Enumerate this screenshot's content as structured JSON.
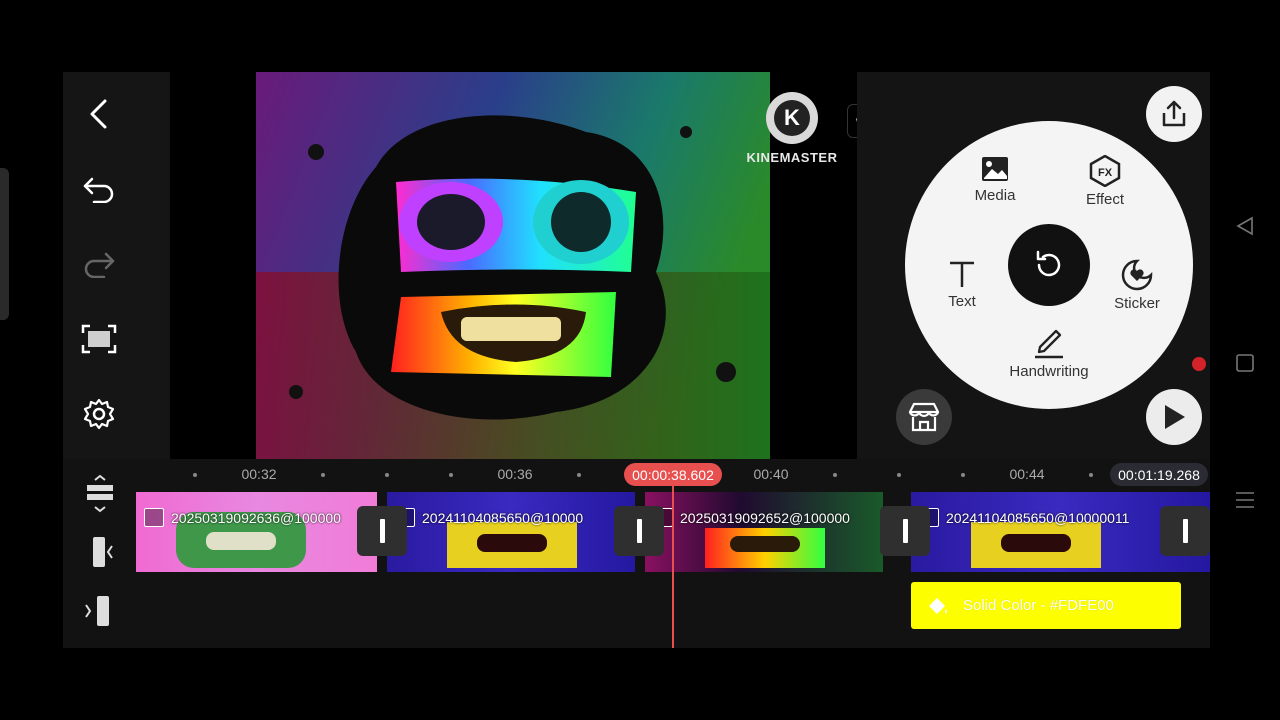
{
  "brand": {
    "name": "KINEMASTER",
    "logo_letter": "K"
  },
  "left_toolbar": [
    "back-icon",
    "undo-icon",
    "redo-icon",
    "fullscreen-icon",
    "settings-icon"
  ],
  "wheel": {
    "media_label": "Media",
    "effect_label": "Effect",
    "text_label": "Text",
    "sticker_label": "Sticker",
    "handwriting_label": "Handwriting"
  },
  "timeline": {
    "ticks": [
      "00:32",
      "00:36",
      "00:40",
      "00:44"
    ],
    "current_time": "00:00:38.602",
    "total_time": "00:01:19.268",
    "clips": [
      {
        "name": "20250319092636@100000"
      },
      {
        "name": "20241104085650@10000"
      },
      {
        "name": "20250319092652@100000"
      },
      {
        "name": "20241104085650@10000011"
      }
    ],
    "solid_layer": "Solid Color - #FDFE00"
  },
  "colors": {
    "playhead": "#e8504f",
    "solid_color": "#FDFE00",
    "record": "#d2232a"
  }
}
